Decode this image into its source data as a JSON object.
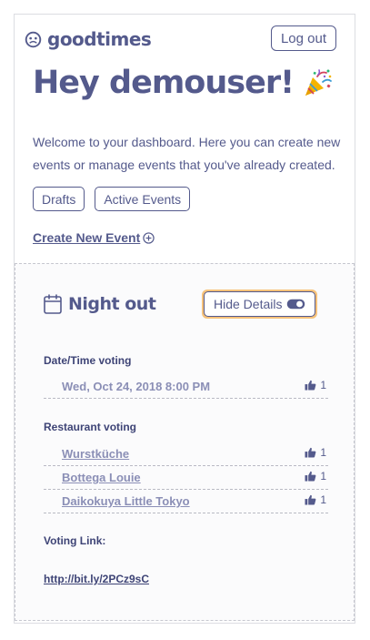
{
  "header": {
    "logo_text": "goodtimes",
    "logout_label": "Log out"
  },
  "greeting": {
    "title": "Hey demouser!",
    "party_icon": "party-popper-icon"
  },
  "welcome": {
    "text": "Welcome to your dashboard. Here you can create new events or manage events that you've already created."
  },
  "tabs": {
    "drafts_label": "Drafts",
    "active_label": "Active Events"
  },
  "create_event": {
    "label": "Create New Event"
  },
  "event": {
    "title": "Night out",
    "hide_details_label": "Hide Details",
    "datetime_section": "Date/Time voting",
    "datetime_options": [
      {
        "label": "Wed, Oct 24, 2018 8:00 PM",
        "votes": "1"
      }
    ],
    "restaurant_section": "Restaurant voting",
    "restaurant_options": [
      {
        "label": "Wurstküche",
        "votes": "1"
      },
      {
        "label": "Bottega Louie",
        "votes": "1"
      },
      {
        "label": "Daikokuya Little Tokyo",
        "votes": "1"
      }
    ],
    "voting_link_label": "Voting Link:",
    "voting_link_url": "http://bit.ly/2PCz9sC"
  },
  "colors": {
    "primary": "#545a8c",
    "muted_link": "#8b8fb6",
    "focus_ring": "#f6c27a"
  }
}
